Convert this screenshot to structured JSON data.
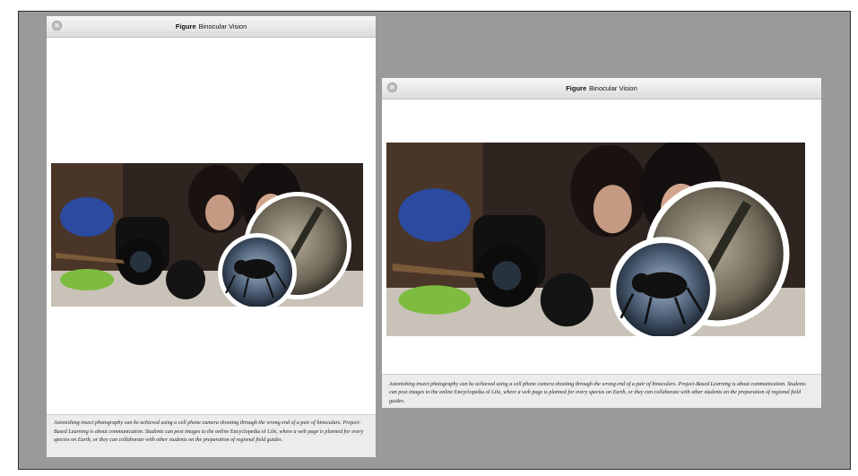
{
  "figure": {
    "label": "Figure",
    "title": "Binocular Vision",
    "caption_part1": "Astonishing insect photography can be achieved using a cell phone camera shooting through the wrong end of a pair of binoculars. Project-Based Learning is about communication. Students can post images to the online ",
    "caption_link": "Encyclopedia of Life",
    "caption_part2": ", where a web page is planned for every species on Earth, or they can collaborate with other students on the preparation of regional field guides."
  },
  "icons": {
    "close": "close-icon"
  },
  "colors": {
    "window_background": "#9a9a9a",
    "titlebar": "#e6e6e6",
    "caption_background": "#ececec"
  }
}
